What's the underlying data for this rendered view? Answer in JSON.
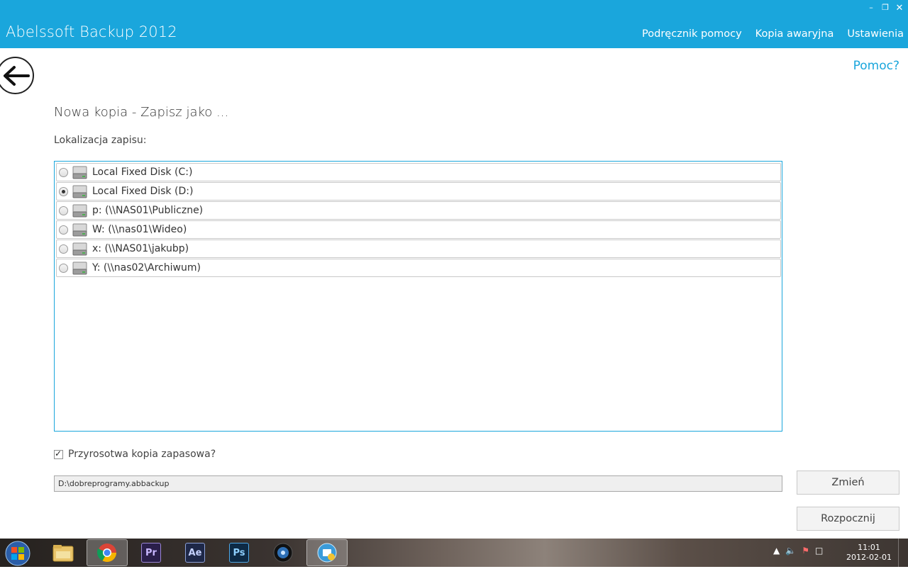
{
  "app": {
    "title": "Abelssoft Backup 2012",
    "accent_color": "#1aa6dc"
  },
  "window_controls": {
    "minimize_icon": "minimize-icon",
    "restore_icon": "restore-icon",
    "close_icon": "close-icon"
  },
  "topnav": {
    "items": [
      "Podręcznik pomocy",
      "Kopia awaryjna",
      "Ustawienia"
    ]
  },
  "help_link": "Pomoc?",
  "heading": "Nowa kopia - Zapisz jako ...",
  "location_label": "Lokalizacja zapisu:",
  "drives": [
    {
      "label": "Local Fixed Disk (C:)",
      "selected": false
    },
    {
      "label": "Local Fixed Disk (D:)",
      "selected": true
    },
    {
      "label": "p: (\\\\NAS01\\Publiczne)",
      "selected": false
    },
    {
      "label": "W: (\\\\nas01\\Wideo)",
      "selected": false
    },
    {
      "label": "x: (\\\\NAS01\\jakubp)",
      "selected": false
    },
    {
      "label": "Y: (\\\\nas02\\Archiwum)",
      "selected": false
    }
  ],
  "incremental": {
    "label": "Przyrosotwa kopia zapasowa?",
    "checked": true
  },
  "path_value": "D:\\dobreprogramy.abbackup",
  "buttons": {
    "change": "Zmień",
    "start": "Rozpocznij"
  },
  "taskbar": {
    "items": [
      {
        "name": "windows-explorer",
        "icon": "folder-icon",
        "active": false
      },
      {
        "name": "chrome",
        "icon": "chrome-icon",
        "active": true
      },
      {
        "name": "premiere",
        "icon": "premiere-icon",
        "text": "Pr",
        "active": false
      },
      {
        "name": "after-effects",
        "icon": "after-effects-icon",
        "text": "Ae",
        "active": false
      },
      {
        "name": "photoshop",
        "icon": "photoshop-icon",
        "text": "Ps",
        "active": false
      },
      {
        "name": "media-player",
        "icon": "media-icon",
        "active": false
      },
      {
        "name": "abelssoft-backup",
        "icon": "backup-icon",
        "active": true
      }
    ],
    "clock_time": "11:01",
    "clock_date": "2012-02-01"
  }
}
